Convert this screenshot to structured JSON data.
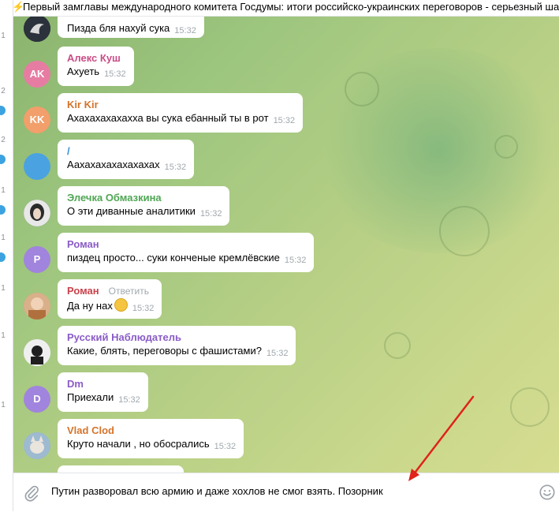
{
  "pinned": {
    "icon": "lightning-icon",
    "text": "Первый замглавы международного комитета Госдумы: итоги российско-украинских переговоров - серьезный шаг вперед"
  },
  "sidebar_partial": {
    "numbers": [
      "1",
      "2",
      "2",
      "1",
      "1",
      "1",
      "1",
      "1"
    ]
  },
  "messages": [
    {
      "sender": "",
      "text": "Пизда бля нахуй сука",
      "time": "15:32",
      "avatar_initials": "",
      "avatar_color": "#2d3540",
      "name_color": ""
    },
    {
      "sender": "Алекс Куш",
      "text": "Ахуеть",
      "time": "15:32",
      "avatar_initials": "AK",
      "avatar_color": "#e77ca3",
      "name_color": "#c94d86"
    },
    {
      "sender": "Kir Kir",
      "text": "Ахахахахахахха вы сука ебанный ты в рот",
      "time": "15:32",
      "avatar_initials": "KK",
      "avatar_color": "#f29f6b",
      "name_color": "#d4742c"
    },
    {
      "sender": "/",
      "text": "Аахахахахахахахах",
      "time": "15:32",
      "avatar_initials": "",
      "avatar_color": "#4aa3e0",
      "name_color": "#3a8fd0"
    },
    {
      "sender": "Элечка Обмазкина",
      "text": "О эти диванные аналитики",
      "time": "15:32",
      "avatar_initials": "",
      "avatar_color": "#3a3a3a",
      "name_color": "#4fa653"
    },
    {
      "sender": "Роман",
      "text": "пиздец просто... суки конченые кремлёвские",
      "time": "15:32",
      "avatar_initials": "P",
      "avatar_color": "#a184dd",
      "name_color": "#8a5cc7"
    },
    {
      "sender": "Роман",
      "text": "Да ну нах",
      "time": "15:32",
      "avatar_initials": "",
      "avatar_color": "#c98f63",
      "name_color": "#c9424b",
      "reply_label": "Ответить",
      "emoji": "slightly-smiling-face-icon"
    },
    {
      "sender": "Русский Наблюдатель",
      "text": "Какие, блять, переговоры с фашистами?",
      "time": "15:32",
      "avatar_initials": "",
      "avatar_color": "#ececec",
      "name_color": "#8a5cc7"
    },
    {
      "sender": "Dm",
      "text": "Приехали",
      "time": "15:32",
      "avatar_initials": "D",
      "avatar_color": "#a184dd",
      "name_color": "#8a5cc7"
    },
    {
      "sender": "Vlad Clod",
      "text": "Круто начали , но обосрались",
      "time": "15:32",
      "avatar_initials": "",
      "avatar_color": "#8fb0c9",
      "name_color": "#d4742c"
    }
  ],
  "composer": {
    "text": "Путин разворовал всю армию и даже хохлов не смог взять. Позорник",
    "attach_icon": "paperclip-icon",
    "emoji_icon": "smile-icon"
  },
  "annotation": {
    "arrow_color": "#e0231b"
  }
}
